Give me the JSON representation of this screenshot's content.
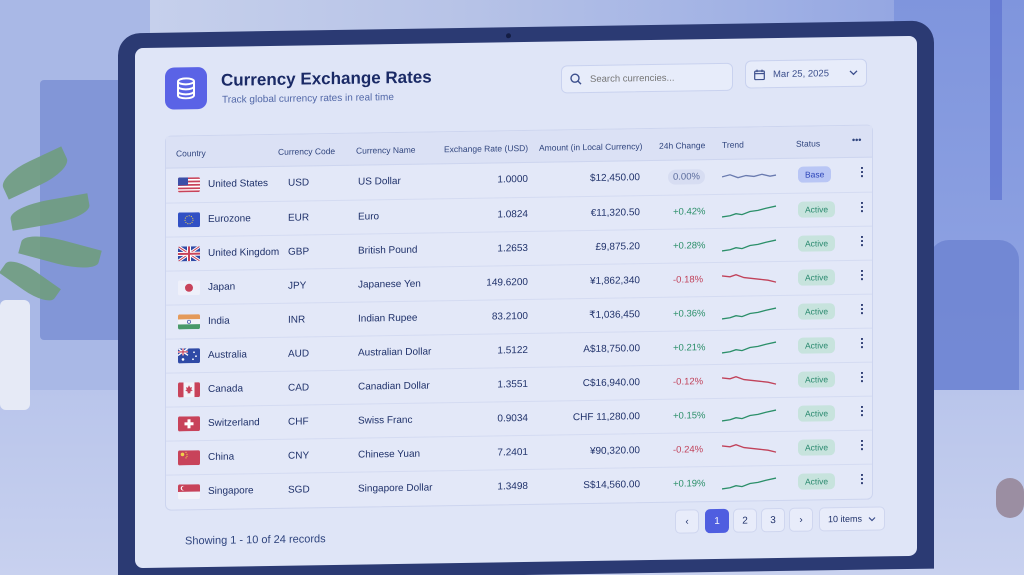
{
  "header": {
    "title": "Currency Exchange Rates",
    "subtitle": "Track global currency rates in real time",
    "search_placeholder": "Search currencies...",
    "date": "Mar 25, 2025"
  },
  "table": {
    "columns": [
      "Country",
      "Currency Code",
      "Currency Name",
      "Exchange Rate (USD)",
      "Amount (in Local Currency)",
      "24h Change",
      "Trend",
      "Status"
    ],
    "more_label": "•••",
    "rows": [
      {
        "country": "United States",
        "code": "USD",
        "name": "US Dollar",
        "rate": "1.0000",
        "amount": "$12,450.00",
        "change": "0.00%",
        "trend": "flat",
        "status": "Base"
      },
      {
        "country": "Eurozone",
        "code": "EUR",
        "name": "Euro",
        "rate": "1.0824",
        "amount": "€11,320.50",
        "change": "+0.42%",
        "trend": "up",
        "status": "Active"
      },
      {
        "country": "United Kingdom",
        "code": "GBP",
        "name": "British Pound",
        "rate": "1.2653",
        "amount": "£9,875.20",
        "change": "+0.28%",
        "trend": "up",
        "status": "Active"
      },
      {
        "country": "Japan",
        "code": "JPY",
        "name": "Japanese Yen",
        "rate": "149.6200",
        "amount": "¥1,862,340",
        "change": "-0.18%",
        "trend": "down",
        "status": "Active"
      },
      {
        "country": "India",
        "code": "INR",
        "name": "Indian Rupee",
        "rate": "83.2100",
        "amount": "₹1,036,450",
        "change": "+0.36%",
        "trend": "up",
        "status": "Active"
      },
      {
        "country": "Australia",
        "code": "AUD",
        "name": "Australian Dollar",
        "rate": "1.5122",
        "amount": "A$18,750.00",
        "change": "+0.21%",
        "trend": "up",
        "status": "Active"
      },
      {
        "country": "Canada",
        "code": "CAD",
        "name": "Canadian Dollar",
        "rate": "1.3551",
        "amount": "C$16,940.00",
        "change": "-0.12%",
        "trend": "down",
        "status": "Active"
      },
      {
        "country": "Switzerland",
        "code": "CHF",
        "name": "Swiss Franc",
        "rate": "0.9034",
        "amount": "CHF 11,280.00",
        "change": "+0.15%",
        "trend": "up",
        "status": "Active"
      },
      {
        "country": "China",
        "code": "CNY",
        "name": "Chinese Yuan",
        "rate": "7.2401",
        "amount": "¥90,320.00",
        "change": "-0.24%",
        "trend": "down",
        "status": "Active"
      },
      {
        "country": "Singapore",
        "code": "SGD",
        "name": "Singapore Dollar",
        "rate": "1.3498",
        "amount": "S$14,560.00",
        "change": "+0.19%",
        "trend": "up",
        "status": "Active"
      }
    ]
  },
  "footer": {
    "showing": "Showing 1 - 10 of 24 records",
    "pages": [
      "1",
      "2",
      "3"
    ],
    "active_page": "1",
    "prev": "‹",
    "next": "›",
    "page_size": "10 items"
  },
  "colors": {
    "accent": "#4f5ee0",
    "positive": "#2b8f69",
    "negative": "#c1425a"
  },
  "icons": {
    "logo": "database-icon",
    "search": "search-icon",
    "date": "calendar-icon",
    "more": "more-horizontal-icon",
    "row_menu": "kebab-icon"
  }
}
